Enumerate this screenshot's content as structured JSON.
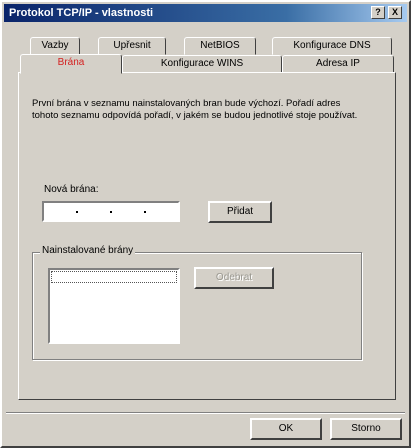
{
  "window": {
    "title": "Protokol TCP/IP - vlastnosti",
    "help_label": "?",
    "close_label": "X"
  },
  "tabs_row1": [
    "Vazby",
    "Upřesnit",
    "NetBIOS",
    "Konfigurace DNS"
  ],
  "tabs_row2": [
    "Brána",
    "Konfigurace WINS",
    "Adresa IP"
  ],
  "active_tab": "Brána",
  "description": "První brána v seznamu nainstalovaných bran bude výchozí. Pořadí adres tohoto seznamu odpovídá pořadí, v jakém se budou jednotlivé stoje používat.",
  "new_gateway": {
    "label": "Nová brána:",
    "value": ""
  },
  "add_button": "Přidat",
  "installed_group": {
    "title": "Nainstalované brány",
    "items": []
  },
  "remove_button": "Odebrat",
  "footer": {
    "ok": "OK",
    "cancel": "Storno"
  },
  "colors": {
    "titlebar": "#0a246a",
    "active_tab_text": "#d42020",
    "face": "#d4d0c8"
  }
}
